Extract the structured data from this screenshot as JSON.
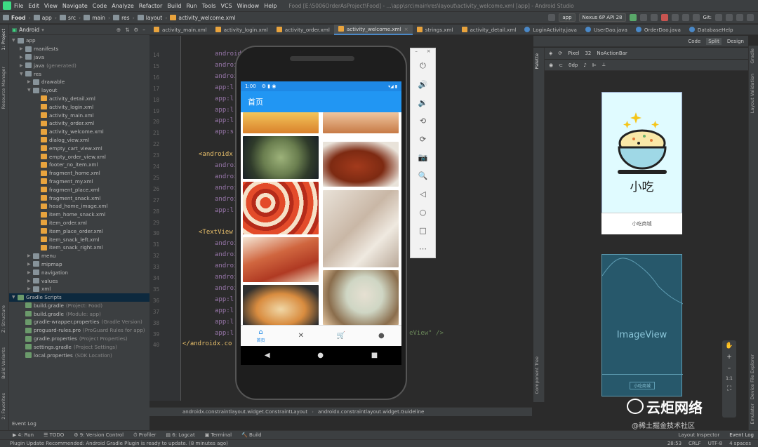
{
  "menu": {
    "items": [
      "File",
      "Edit",
      "View",
      "Navigate",
      "Code",
      "Analyze",
      "Refactor",
      "Build",
      "Run",
      "Tools",
      "VCS",
      "Window",
      "Help"
    ],
    "window_title": "Food [E:\\5006OrderAsProject\\Food] - ...\\app\\src\\main\\res\\layout\\activity_welcome.xml [app] - Android Studio"
  },
  "nav": {
    "crumbs": [
      "Food",
      "app",
      "src",
      "main",
      "res",
      "layout",
      "activity_welcome.xml"
    ],
    "run_config": "app",
    "device": "Nexus 6P API 28",
    "git": "Git:"
  },
  "project": {
    "header": "Android",
    "side_tabs": [
      "1: Project",
      "Resource Manager",
      "Z: Structure",
      "Build Variants",
      "2: Favorites"
    ],
    "tree": [
      {
        "label": "app",
        "indent": 0,
        "type": "folder",
        "arrow": "▼"
      },
      {
        "label": "manifests",
        "indent": 1,
        "type": "folder",
        "arrow": "▶"
      },
      {
        "label": "java",
        "indent": 1,
        "type": "folder",
        "arrow": "▶"
      },
      {
        "label": "java",
        "sub": "(generated)",
        "indent": 1,
        "type": "folder",
        "arrow": "▶"
      },
      {
        "label": "res",
        "indent": 1,
        "type": "folder",
        "arrow": "▼"
      },
      {
        "label": "drawable",
        "indent": 2,
        "type": "folder",
        "arrow": "▶"
      },
      {
        "label": "layout",
        "indent": 2,
        "type": "folder",
        "arrow": "▼"
      },
      {
        "label": "activity_detail.xml",
        "indent": 3,
        "type": "xml"
      },
      {
        "label": "activity_login.xml",
        "indent": 3,
        "type": "xml"
      },
      {
        "label": "activity_main.xml",
        "indent": 3,
        "type": "xml"
      },
      {
        "label": "activity_order.xml",
        "indent": 3,
        "type": "xml"
      },
      {
        "label": "activity_welcome.xml",
        "indent": 3,
        "type": "xml"
      },
      {
        "label": "dialog_view.xml",
        "indent": 3,
        "type": "xml"
      },
      {
        "label": "empty_cart_view.xml",
        "indent": 3,
        "type": "xml"
      },
      {
        "label": "empty_order_view.xml",
        "indent": 3,
        "type": "xml"
      },
      {
        "label": "footer_no_item.xml",
        "indent": 3,
        "type": "xml"
      },
      {
        "label": "fragment_home.xml",
        "indent": 3,
        "type": "xml"
      },
      {
        "label": "fragment_my.xml",
        "indent": 3,
        "type": "xml"
      },
      {
        "label": "fragment_place.xml",
        "indent": 3,
        "type": "xml"
      },
      {
        "label": "fragment_snack.xml",
        "indent": 3,
        "type": "xml"
      },
      {
        "label": "head_home_image.xml",
        "indent": 3,
        "type": "xml"
      },
      {
        "label": "item_home_snack.xml",
        "indent": 3,
        "type": "xml"
      },
      {
        "label": "item_order.xml",
        "indent": 3,
        "type": "xml"
      },
      {
        "label": "item_place_order.xml",
        "indent": 3,
        "type": "xml"
      },
      {
        "label": "item_snack_left.xml",
        "indent": 3,
        "type": "xml"
      },
      {
        "label": "item_snack_right.xml",
        "indent": 3,
        "type": "xml"
      },
      {
        "label": "menu",
        "indent": 2,
        "type": "folder",
        "arrow": "▶"
      },
      {
        "label": "mipmap",
        "indent": 2,
        "type": "folder",
        "arrow": "▶"
      },
      {
        "label": "navigation",
        "indent": 2,
        "type": "folder",
        "arrow": "▶"
      },
      {
        "label": "values",
        "indent": 2,
        "type": "folder",
        "arrow": "▶"
      },
      {
        "label": "xml",
        "indent": 2,
        "type": "folder",
        "arrow": "▶"
      },
      {
        "label": "Gradle Scripts",
        "indent": 0,
        "type": "gradle",
        "arrow": "▼",
        "selected": true
      },
      {
        "label": "build.gradle",
        "sub": "(Project: Food)",
        "indent": 1,
        "type": "gradle"
      },
      {
        "label": "build.gradle",
        "sub": "(Module: app)",
        "indent": 1,
        "type": "gradle"
      },
      {
        "label": "gradle-wrapper.properties",
        "sub": "(Gradle Version)",
        "indent": 1,
        "type": "gradle"
      },
      {
        "label": "proguard-rules.pro",
        "sub": "(ProGuard Rules for app)",
        "indent": 1,
        "type": "gradle"
      },
      {
        "label": "gradle.properties",
        "sub": "(Project Properties)",
        "indent": 1,
        "type": "gradle"
      },
      {
        "label": "settings.gradle",
        "sub": "(Project Settings)",
        "indent": 1,
        "type": "gradle"
      },
      {
        "label": "local.properties",
        "sub": "(SDK Location)",
        "indent": 1,
        "type": "gradle"
      }
    ]
  },
  "tabs": [
    {
      "label": "activity_main.xml",
      "icon": "xml"
    },
    {
      "label": "activity_login.xml",
      "icon": "xml"
    },
    {
      "label": "activity_order.xml",
      "icon": "xml"
    },
    {
      "label": "activity_welcome.xml",
      "icon": "xml",
      "active": true
    },
    {
      "label": "strings.xml",
      "icon": "xml"
    },
    {
      "label": "activity_detail.xml",
      "icon": "xml"
    },
    {
      "label": "LoginActivity.java",
      "icon": "java"
    },
    {
      "label": "UserDao.java",
      "icon": "java"
    },
    {
      "label": "OrderDao.java",
      "icon": "java"
    },
    {
      "label": "DatabaseHelp",
      "icon": "java"
    }
  ],
  "code": {
    "lines": [
      {
        "n": "14",
        "text": "android"
      },
      {
        "n": "15",
        "text": "android"
      },
      {
        "n": "16",
        "text": "android"
      },
      {
        "n": "17",
        "text": "app:l"
      },
      {
        "n": "18",
        "text": "app:l"
      },
      {
        "n": "19",
        "text": "app:l"
      },
      {
        "n": "20",
        "text": "app:l"
      },
      {
        "n": "21",
        "text": "app:s"
      },
      {
        "n": "22",
        "text": ""
      },
      {
        "n": "23",
        "text": "<androidx"
      },
      {
        "n": "24",
        "text": "androi"
      },
      {
        "n": "25",
        "text": "androi"
      },
      {
        "n": "26",
        "text": "androi"
      },
      {
        "n": "27",
        "text": "androi"
      },
      {
        "n": "28",
        "text": "app:l"
      },
      {
        "n": "29",
        "text": ""
      },
      {
        "n": "30",
        "text": "<TextView"
      },
      {
        "n": "31",
        "text": "androi"
      },
      {
        "n": "32",
        "text": "androi"
      },
      {
        "n": "33",
        "text": "androi"
      },
      {
        "n": "34",
        "text": "androi"
      },
      {
        "n": "35",
        "text": "androi"
      },
      {
        "n": "36",
        "text": "app:l"
      },
      {
        "n": "37",
        "text": "app:l"
      },
      {
        "n": "38",
        "text": "app:l"
      },
      {
        "n": "39",
        "text": "app:l"
      },
      {
        "n": "40",
        "text": "</androidx.co"
      }
    ],
    "tail_39": "eView\" />",
    "breadcrumb": [
      "androidx.constraintlayout.widget.ConstraintLayout",
      "androidx.constraintlayout.widget.Guideline"
    ]
  },
  "phone": {
    "time": "1:00",
    "status_right": "▾◢ ▮",
    "app_title": "首页",
    "bottom_nav": [
      {
        "icon": "home-icon",
        "glyph": "⌂",
        "label": "首页",
        "active": true
      },
      {
        "icon": "utensils-icon",
        "glyph": "✕",
        "label": ""
      },
      {
        "icon": "cart-icon",
        "glyph": "🛒",
        "label": ""
      },
      {
        "icon": "person-icon",
        "glyph": "●",
        "label": ""
      }
    ],
    "system_nav": [
      "◀",
      "●",
      "■"
    ]
  },
  "emulator_toolbar": {
    "header": [
      "–",
      "×"
    ],
    "buttons": [
      {
        "name": "power-icon",
        "glyph": "⏻"
      },
      {
        "name": "volume-up-icon",
        "glyph": "🔊"
      },
      {
        "name": "volume-down-icon",
        "glyph": "🔉"
      },
      {
        "name": "rotate-left-icon",
        "glyph": "⟲"
      },
      {
        "name": "rotate-right-icon",
        "glyph": "⟳"
      },
      {
        "name": "camera-icon",
        "glyph": "📷"
      },
      {
        "name": "zoom-icon",
        "glyph": "🔍"
      },
      {
        "name": "back-icon",
        "glyph": "◁"
      },
      {
        "name": "home-icon",
        "glyph": "○"
      },
      {
        "name": "overview-icon",
        "glyph": "□"
      },
      {
        "name": "more-icon",
        "glyph": "⋯"
      }
    ]
  },
  "design": {
    "modes": [
      "Code",
      "Split",
      "Design"
    ],
    "toolbar": [
      "Pixel",
      "32",
      "NoActionBar"
    ],
    "toolbar2": [
      "0dp"
    ],
    "side_tabs_left": [
      "Palette",
      "Component Tree"
    ],
    "side_tabs_right": [
      "Gradle",
      "Layout Validation",
      "Device File Explorer",
      "Emulator"
    ],
    "preview_title": "小吃",
    "preview_bottom": "小吃商城",
    "blueprint_label": "ImageView",
    "blueprint_button": "小吃商城",
    "zoom": [
      "✋",
      "+",
      "–",
      "1:1",
      "⛶"
    ]
  },
  "bottom": {
    "event_log": "Event Log",
    "tools": [
      "▶ 4: Run",
      "☰ TODO",
      "⚙ 9: Version Control",
      "⏱ Profiler",
      "▤ 6: Logcat",
      "▣ Terminal",
      "🔨 Build"
    ],
    "right_tools": [
      "Layout Inspector",
      "Event Log"
    ],
    "status": "Plugin Update Recommended: Android Gradle Plugin is ready to update. (8 minutes ago)",
    "status_right": [
      "28:53",
      "CRLF",
      "UTF-8",
      "4 spaces"
    ]
  },
  "watermark": {
    "main": "云炬网络",
    "sub": "@稀土掘金技术社区"
  },
  "colors": {
    "accent": "#2196f3",
    "ide_bg": "#2b2b2b",
    "panel": "#3c3f41",
    "xml_tag": "#e8bf6a",
    "attr": "#9876aa"
  }
}
